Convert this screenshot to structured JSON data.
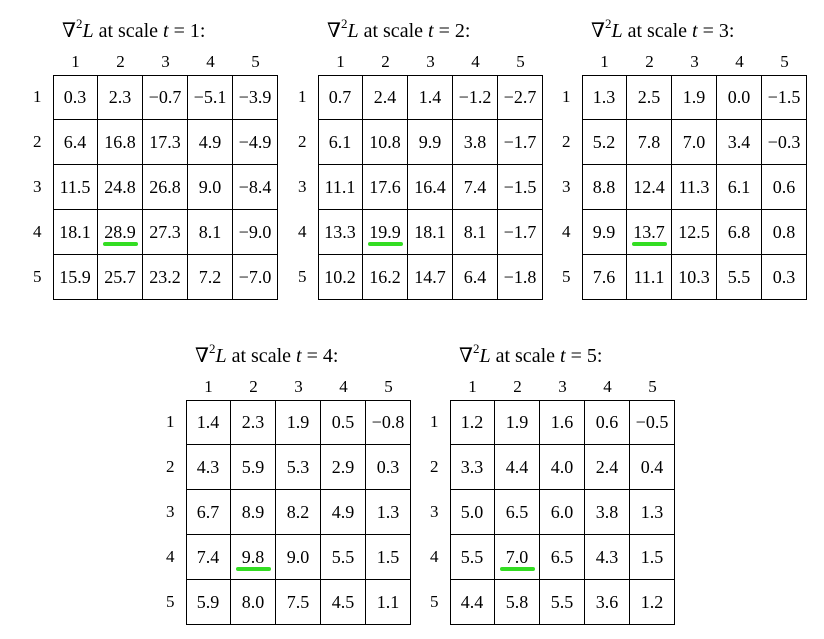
{
  "tables": [
    {
      "title": {
        "op": "∇",
        "sup": "2",
        "var": "L",
        "text": "at scale",
        "param": "t",
        "eq": "= 1:"
      },
      "col_labels": [
        "1",
        "2",
        "3",
        "4",
        "5"
      ],
      "row_labels": [
        "1",
        "2",
        "3",
        "4",
        "5"
      ],
      "rows": [
        [
          "0.3",
          "2.3",
          "−0.7",
          "−5.1",
          "−3.9"
        ],
        [
          "6.4",
          "16.8",
          "17.3",
          "4.9",
          "−4.9"
        ],
        [
          "11.5",
          "24.8",
          "26.8",
          "9.0",
          "−8.4"
        ],
        [
          "18.1",
          "28.9",
          "27.3",
          "8.1",
          "−9.0"
        ],
        [
          "15.9",
          "25.7",
          "23.2",
          "7.2",
          "−7.0"
        ]
      ],
      "highlight": {
        "row": 4,
        "col": 2
      },
      "highlight_color": "#33dd22"
    },
    {
      "title": {
        "op": "∇",
        "sup": "2",
        "var": "L",
        "text": "at scale",
        "param": "t",
        "eq": "= 2:"
      },
      "col_labels": [
        "1",
        "2",
        "3",
        "4",
        "5"
      ],
      "row_labels": [
        "1",
        "2",
        "3",
        "4",
        "5"
      ],
      "rows": [
        [
          "0.7",
          "2.4",
          "1.4",
          "−1.2",
          "−2.7"
        ],
        [
          "6.1",
          "10.8",
          "9.9",
          "3.8",
          "−1.7"
        ],
        [
          "11.1",
          "17.6",
          "16.4",
          "7.4",
          "−1.5"
        ],
        [
          "13.3",
          "19.9",
          "18.1",
          "8.1",
          "−1.7"
        ],
        [
          "10.2",
          "16.2",
          "14.7",
          "6.4",
          "−1.8"
        ]
      ],
      "highlight": {
        "row": 4,
        "col": 2
      },
      "highlight_color": "#33dd22"
    },
    {
      "title": {
        "op": "∇",
        "sup": "2",
        "var": "L",
        "text": "at scale",
        "param": "t",
        "eq": "= 3:"
      },
      "col_labels": [
        "1",
        "2",
        "3",
        "4",
        "5"
      ],
      "row_labels": [
        "1",
        "2",
        "3",
        "4",
        "5"
      ],
      "rows": [
        [
          "1.3",
          "2.5",
          "1.9",
          "0.0",
          "−1.5"
        ],
        [
          "5.2",
          "7.8",
          "7.0",
          "3.4",
          "−0.3"
        ],
        [
          "8.8",
          "12.4",
          "11.3",
          "6.1",
          "0.6"
        ],
        [
          "9.9",
          "13.7",
          "12.5",
          "6.8",
          "0.8"
        ],
        [
          "7.6",
          "11.1",
          "10.3",
          "5.5",
          "0.3"
        ]
      ],
      "highlight": {
        "row": 4,
        "col": 2
      },
      "highlight_color": "#33dd22"
    },
    {
      "title": {
        "op": "∇",
        "sup": "2",
        "var": "L",
        "text": "at scale",
        "param": "t",
        "eq": "= 4:"
      },
      "col_labels": [
        "1",
        "2",
        "3",
        "4",
        "5"
      ],
      "row_labels": [
        "1",
        "2",
        "3",
        "4",
        "5"
      ],
      "rows": [
        [
          "1.4",
          "2.3",
          "1.9",
          "0.5",
          "−0.8"
        ],
        [
          "4.3",
          "5.9",
          "5.3",
          "2.9",
          "0.3"
        ],
        [
          "6.7",
          "8.9",
          "8.2",
          "4.9",
          "1.3"
        ],
        [
          "7.4",
          "9.8",
          "9.0",
          "5.5",
          "1.5"
        ],
        [
          "5.9",
          "8.0",
          "7.5",
          "4.5",
          "1.1"
        ]
      ],
      "highlight": {
        "row": 4,
        "col": 2
      },
      "highlight_color": "#33dd22"
    },
    {
      "title": {
        "op": "∇",
        "sup": "2",
        "var": "L",
        "text": "at scale",
        "param": "t",
        "eq": "= 5:"
      },
      "col_labels": [
        "1",
        "2",
        "3",
        "4",
        "5"
      ],
      "row_labels": [
        "1",
        "2",
        "3",
        "4",
        "5"
      ],
      "rows": [
        [
          "1.2",
          "1.9",
          "1.6",
          "0.6",
          "−0.5"
        ],
        [
          "3.3",
          "4.4",
          "4.0",
          "2.4",
          "0.4"
        ],
        [
          "5.0",
          "6.5",
          "6.0",
          "3.8",
          "1.3"
        ],
        [
          "5.5",
          "7.0",
          "6.5",
          "4.3",
          "1.5"
        ],
        [
          "4.4",
          "5.8",
          "5.5",
          "3.6",
          "1.2"
        ]
      ],
      "highlight": {
        "row": 4,
        "col": 2
      },
      "highlight_color": "#33dd22"
    }
  ]
}
